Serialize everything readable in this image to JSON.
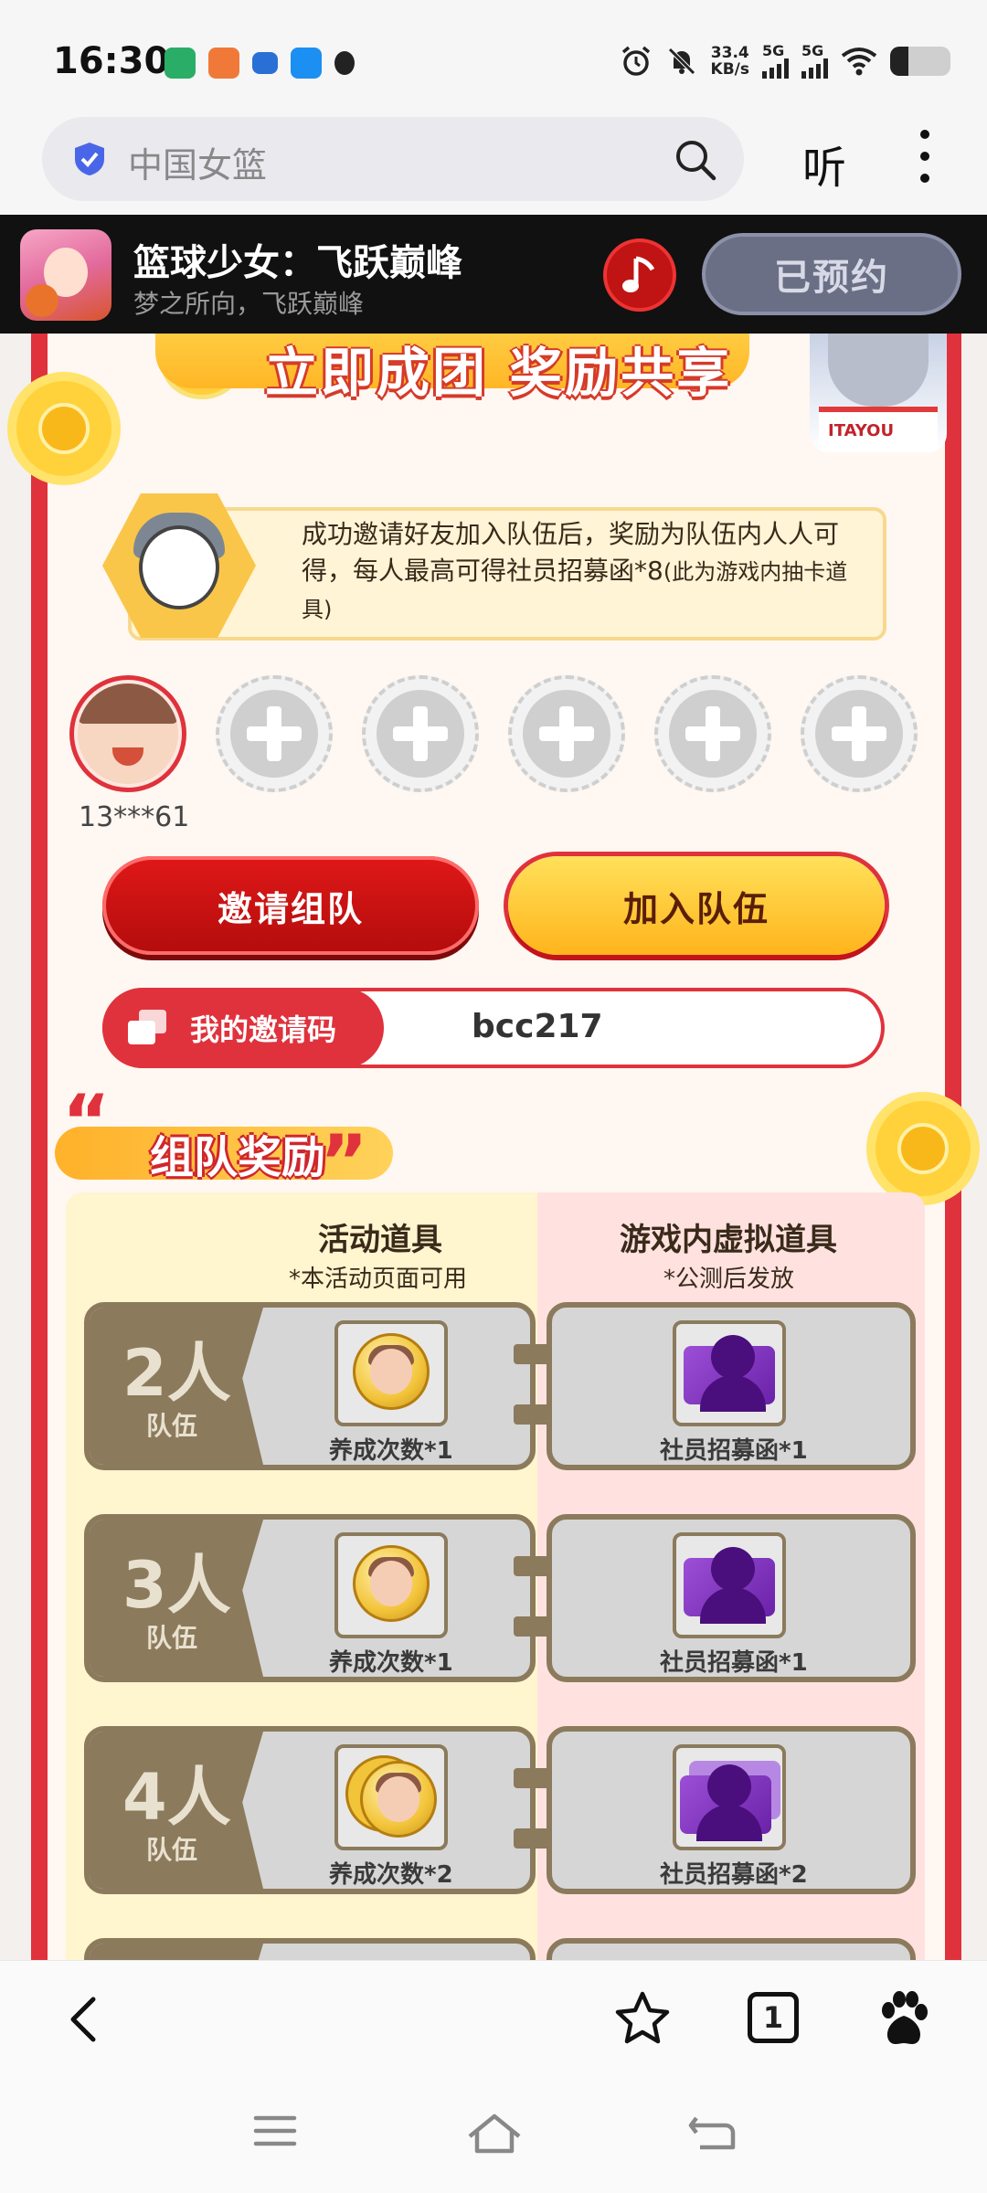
{
  "status_bar": {
    "time": "16:30",
    "net_speed_value": "33.4",
    "net_speed_unit": "KB/s",
    "sim1_label": "5G",
    "sim2_label": "5G",
    "battery_level": 0.3,
    "notification_icons": [
      "wechat-icon",
      "orange-app-icon",
      "blue-app-icon",
      "blue-app2-icon",
      "qq-icon"
    ]
  },
  "browser": {
    "search_text": "中国女篮",
    "listen_label": "听",
    "tab_count": "1"
  },
  "promo": {
    "title": "篮球少女：飞跃巅峰",
    "subtitle": "梦之所向，飞跃巅峰",
    "reserved_label": "已预约"
  },
  "event": {
    "header_title": "立即成团 奖励共享",
    "mascot_shirt_text": "ITAYOU",
    "info_text": "成功邀请好友加入队伍后，奖励为队伍内人人可得，每人最高可得社员招募函*8",
    "info_note": "(此为游戏内抽卡道具)",
    "member_name": "13***61",
    "empty_slots": 5,
    "invite_button": "邀请组队",
    "join_button": "加入队伍",
    "invite_code_label": "我的邀请码",
    "invite_code": "bcc217",
    "rewards_title": "组队奖励",
    "col_activity_title": "活动道具",
    "col_activity_sub": "*本活动页面可用",
    "col_game_title": "游戏内虚拟道具",
    "col_game_sub": "*公测后发放",
    "tiers": [
      {
        "size": "2人",
        "team": "队伍",
        "activity_item": "养成次数*1",
        "game_item": "社员招募函*1"
      },
      {
        "size": "3人",
        "team": "队伍",
        "activity_item": "养成次数*1",
        "game_item": "社员招募函*1"
      },
      {
        "size": "4人",
        "team": "队伍",
        "activity_item": "养成次数*2",
        "game_item": "社员招募函*2"
      }
    ]
  },
  "colors": {
    "brand_red": "#e0323c",
    "gold": "#ffc83a",
    "tier_brown": "#8b7a5c"
  }
}
